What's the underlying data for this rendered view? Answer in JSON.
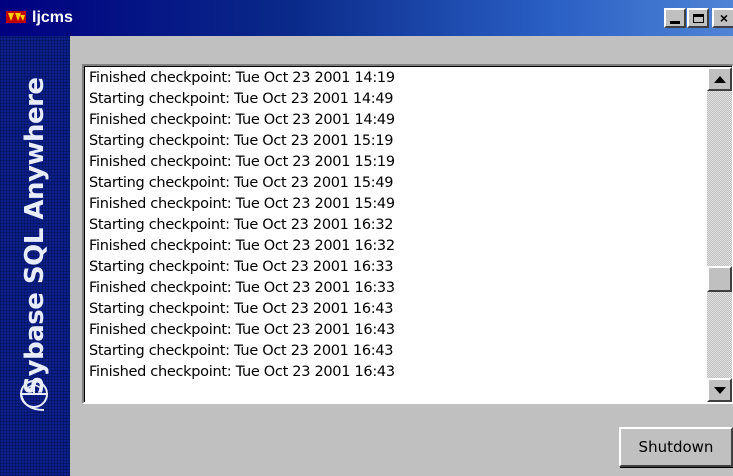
{
  "window": {
    "title": "ljcms",
    "app_icon": "sybase-app-icon",
    "controls": {
      "minimize": "minimize-icon",
      "maximize": "maximize-icon",
      "close": "×"
    }
  },
  "banner": {
    "text": "Sybase SQL Anywhere",
    "logo_icon": "sybase-logo-icon",
    "color": "#0a1e8c"
  },
  "log": {
    "lines": [
      "Finished checkpoint: Tue Oct 23 2001 14:19",
      "Starting checkpoint: Tue Oct 23 2001 14:49",
      "Finished checkpoint: Tue Oct 23 2001 14:49",
      "Starting checkpoint: Tue Oct 23 2001 15:19",
      "Finished checkpoint: Tue Oct 23 2001 15:19",
      "Starting checkpoint: Tue Oct 23 2001 15:49",
      "Finished checkpoint: Tue Oct 23 2001 15:49",
      "Starting checkpoint: Tue Oct 23 2001 16:32",
      "Finished checkpoint: Tue Oct 23 2001 16:32",
      "Starting checkpoint: Tue Oct 23 2001 16:33",
      "Finished checkpoint: Tue Oct 23 2001 16:33",
      "Starting checkpoint: Tue Oct 23 2001 16:43",
      "Finished checkpoint: Tue Oct 23 2001 16:43",
      "Starting checkpoint: Tue Oct 23 2001 16:43",
      "Finished checkpoint: Tue Oct 23 2001 16:43"
    ],
    "scroll_position": 0.67
  },
  "buttons": {
    "shutdown": "Shutdown"
  },
  "colors": {
    "title_start": "#000080",
    "title_end": "#4f84d6",
    "face": "#c0c0c0"
  }
}
